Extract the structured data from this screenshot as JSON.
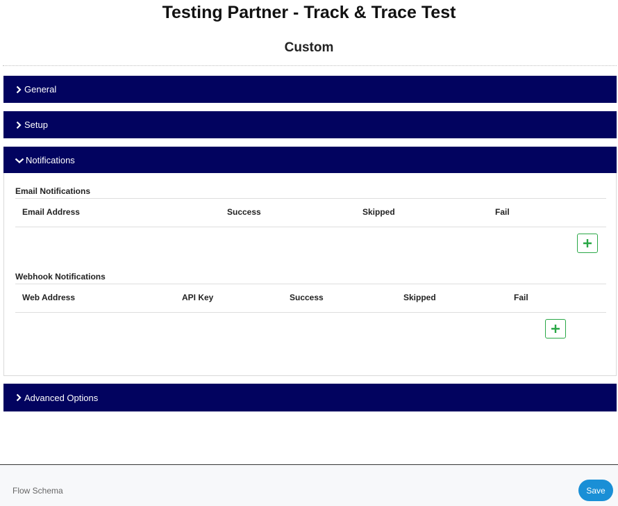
{
  "header": {
    "title": "Testing Partner - Track & Trace Test",
    "subtitle": "Custom"
  },
  "sections": {
    "general": {
      "label": "General",
      "state": "collapsed"
    },
    "setup": {
      "label": "Setup",
      "state": "collapsed"
    },
    "notifications": {
      "label": "Notifications",
      "state": "expanded"
    },
    "advanced": {
      "label": "Advanced Options",
      "state": "collapsed"
    }
  },
  "notifications": {
    "email": {
      "heading": "Email Notifications",
      "columns": [
        "Email Address",
        "Success",
        "Skipped",
        "Fail"
      ],
      "rows": []
    },
    "webhook": {
      "heading": "Webhook Notifications",
      "columns": [
        "Web Address",
        "API Key",
        "Success",
        "Skipped",
        "Fail"
      ],
      "rows": []
    }
  },
  "footer": {
    "link_label": "Flow Schema",
    "save_label": "Save"
  },
  "colors": {
    "section_header_bg": "#02035f",
    "add_button_accent": "#28a745",
    "save_button_bg": "#1a8fd6"
  },
  "icons": {
    "collapsed": "chevron-right-icon",
    "expanded": "chevron-down-icon",
    "add": "plus-icon"
  }
}
